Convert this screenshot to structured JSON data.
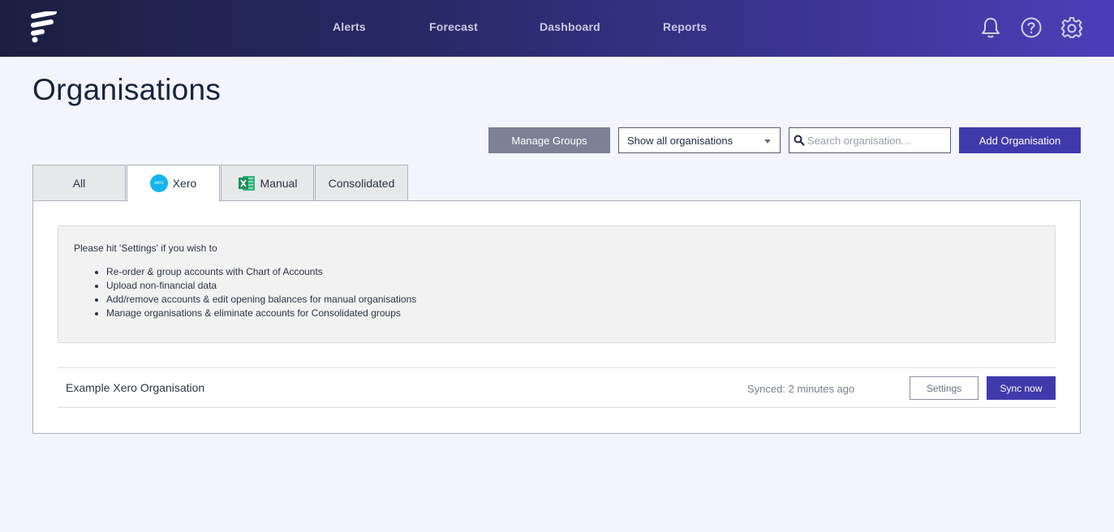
{
  "header": {
    "nav": [
      "Alerts",
      "Forecast",
      "Dashboard",
      "Reports"
    ],
    "icons": [
      "bell-icon",
      "help-icon",
      "gear-icon"
    ]
  },
  "page": {
    "title": "Organisations"
  },
  "toolbar": {
    "manage_groups_label": "Manage Groups",
    "filter_value": "Show all organisations",
    "search_placeholder": "Search organisation...",
    "search_value": "",
    "add_label": "Add Organisation"
  },
  "tabs": [
    {
      "label": "All",
      "active": false
    },
    {
      "label": "Xero",
      "active": true,
      "icon": "xero-logo-icon",
      "icon_text": "xero"
    },
    {
      "label": "Manual",
      "active": false,
      "icon": "excel-icon"
    },
    {
      "label": "Consolidated",
      "active": false
    }
  ],
  "info": {
    "intro": "Please hit 'Settings' if you wish to",
    "items": [
      "Re-order & group accounts with Chart of Accounts",
      "Upload non-financial data",
      "Add/remove accounts & edit opening balances for manual organisations",
      "Manage organisations & eliminate accounts for Consolidated groups"
    ]
  },
  "organisations": [
    {
      "name": "Example Xero Organisation",
      "synced": "Synced: 2 minutes ago",
      "settings_label": "Settings",
      "sync_label": "Sync now"
    }
  ],
  "colors": {
    "accent": "#3f3aab",
    "header_start": "#1b1f3f",
    "header_end": "#4a3fb8",
    "page_bg": "#f3f5fc",
    "xero": "#13b5ea",
    "excel": "#1d8f5a"
  }
}
